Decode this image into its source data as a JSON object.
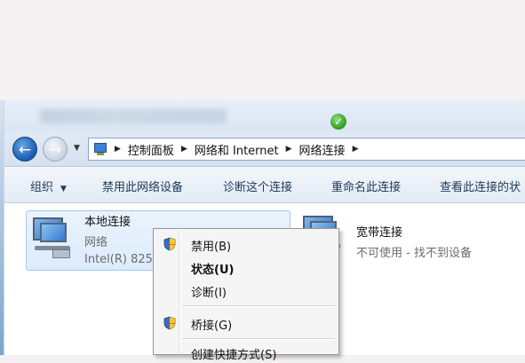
{
  "address_bar": {
    "crumbs": [
      "控制面板",
      "网络和 Internet",
      "网络连接"
    ]
  },
  "toolbar": {
    "organize": "组织",
    "disable": "禁用此网络设备",
    "diagnose": "诊断这个连接",
    "rename": "重命名此连接",
    "view_status": "查看此连接的状"
  },
  "connections": [
    {
      "name": "本地连接",
      "type": "网络",
      "device": "Intel(R) 825"
    },
    {
      "name": "宽带连接",
      "status": "不可使用 - 找不到设备"
    }
  ],
  "context_menu": {
    "items": [
      {
        "label": "禁用(B)",
        "icon": "uac-shield-icon"
      },
      {
        "label": "状态(U)",
        "bold": true
      },
      {
        "label": "诊断(I)"
      },
      {
        "label": "桥接(G)",
        "icon": "uac-shield-icon"
      },
      {
        "label": "创建快捷方式(S)"
      }
    ]
  },
  "colors": {
    "toolbar_text": "#1e395b",
    "selection": "#dcebfc"
  }
}
